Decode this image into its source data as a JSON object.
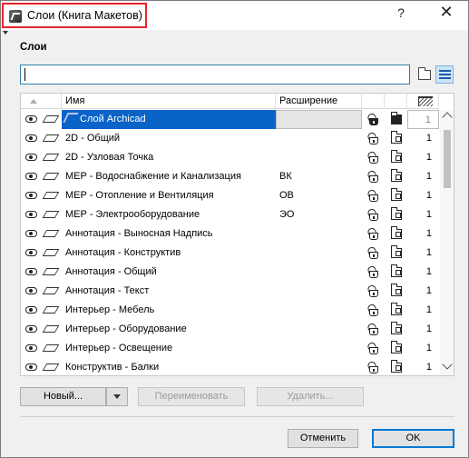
{
  "window": {
    "title": "Слои (Книга Макетов)",
    "help_label": "?",
    "close_label": "✕"
  },
  "section": {
    "label": "Слои"
  },
  "search": {
    "value": "",
    "placeholder": ""
  },
  "table": {
    "columns": {
      "name": "Имя",
      "extension": "Расширение"
    },
    "rows": [
      {
        "name": "Слой Archicad",
        "extension": "",
        "intersection": "1",
        "selected": true,
        "special": true
      },
      {
        "name": "2D - Общий",
        "extension": "",
        "intersection": "1"
      },
      {
        "name": "2D - Узловая Точка",
        "extension": "",
        "intersection": "1"
      },
      {
        "name": "MEP - Водоснабжение и Канализация",
        "extension": "ВК",
        "intersection": "1"
      },
      {
        "name": "MEP - Отопление и Вентиляция",
        "extension": "ОВ",
        "intersection": "1"
      },
      {
        "name": "MEP - Электрооборудование",
        "extension": "ЭО",
        "intersection": "1"
      },
      {
        "name": "Аннотация - Выносная Надпись",
        "extension": "",
        "intersection": "1"
      },
      {
        "name": "Аннотация - Конструктив",
        "extension": "",
        "intersection": "1"
      },
      {
        "name": "Аннотация - Общий",
        "extension": "",
        "intersection": "1"
      },
      {
        "name": "Аннотация - Текст",
        "extension": "",
        "intersection": "1"
      },
      {
        "name": "Интерьер - Мебель",
        "extension": "",
        "intersection": "1"
      },
      {
        "name": "Интерьер - Оборудование",
        "extension": "",
        "intersection": "1"
      },
      {
        "name": "Интерьер - Освещение",
        "extension": "",
        "intersection": "1"
      },
      {
        "name": "Конструктив - Балки",
        "extension": "",
        "intersection": "1"
      }
    ]
  },
  "buttons": {
    "new": "Новый...",
    "rename": "Переименовать",
    "delete": "Удалить...",
    "cancel": "Отменить",
    "ok": "OK"
  },
  "colors": {
    "selection": "#0a64c8",
    "title_highlight": "#e8242b",
    "default_button_border": "#0078d7"
  }
}
